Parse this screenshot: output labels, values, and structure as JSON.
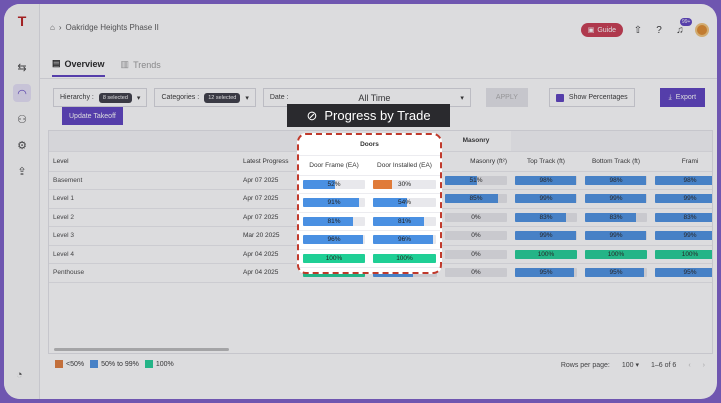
{
  "breadcrumb": {
    "project": "Oakridge Heights Phase II"
  },
  "header": {
    "guide_label": "Guide",
    "notif_badge": "99+"
  },
  "tabs": [
    {
      "label": "Overview"
    },
    {
      "label": "Trends"
    }
  ],
  "filters": {
    "hierarchy_label": "Hierarchy :",
    "hierarchy_value": "8 selected",
    "categories_label": "Categories :",
    "categories_value": "12 selected",
    "date_label": "Date :",
    "date_value": "All Time",
    "apply_label": "APPLY",
    "show_pct_label": "Show Percentages",
    "export_label": "Export",
    "update_label": "Update Takeoff"
  },
  "tooltip": {
    "title": "Progress by Trade"
  },
  "table": {
    "groups": {
      "doors": "Doors",
      "masonry": "Masonry"
    },
    "columns": [
      "Level",
      "Latest Progress",
      "Door Frame (EA)",
      "Door Installed (EA)",
      "Masonry (ft²)",
      "Top Track (ft)",
      "Bottom Track (ft)",
      "Frami"
    ],
    "rows": [
      {
        "level": "Basement",
        "date": "Apr 07 2025",
        "vals": [
          "52%",
          "30%",
          "51%",
          "98%",
          "98%",
          "98%"
        ],
        "pct": [
          52,
          30,
          51,
          98,
          98,
          98
        ]
      },
      {
        "level": "Level 1",
        "date": "Apr 07 2025",
        "vals": [
          "91%",
          "54%",
          "85%",
          "99%",
          "99%",
          "99%"
        ],
        "pct": [
          91,
          54,
          85,
          99,
          99,
          99
        ]
      },
      {
        "level": "Level 2",
        "date": "Apr 07 2025",
        "vals": [
          "81%",
          "81%",
          "0%",
          "83%",
          "83%",
          "83%"
        ],
        "pct": [
          81,
          81,
          0,
          83,
          83,
          83
        ]
      },
      {
        "level": "Level 3",
        "date": "Mar 20 2025",
        "vals": [
          "96%",
          "96%",
          "0%",
          "99%",
          "99%",
          "99%"
        ],
        "pct": [
          96,
          96,
          0,
          99,
          99,
          99
        ]
      },
      {
        "level": "Level 4",
        "date": "Apr 04 2025",
        "vals": [
          "100%",
          "100%",
          "0%",
          "100%",
          "100%",
          "100%"
        ],
        "pct": [
          100,
          100,
          0,
          100,
          100,
          100
        ]
      },
      {
        "level": "Penthouse",
        "date": "Apr 04 2025",
        "vals": [
          "100%",
          "63%",
          "0%",
          "95%",
          "95%",
          "95%"
        ],
        "pct": [
          100,
          63,
          0,
          95,
          95,
          95
        ]
      }
    ]
  },
  "legend": [
    {
      "label": "<50%",
      "color": "#e07b39"
    },
    {
      "label": "50% to 99%",
      "color": "#4a90e2"
    },
    {
      "label": "100%",
      "color": "#1fcf95"
    }
  ],
  "pager": {
    "rows_label": "Rows per page:",
    "rows_value": "100",
    "range": "1–6 of 6"
  }
}
